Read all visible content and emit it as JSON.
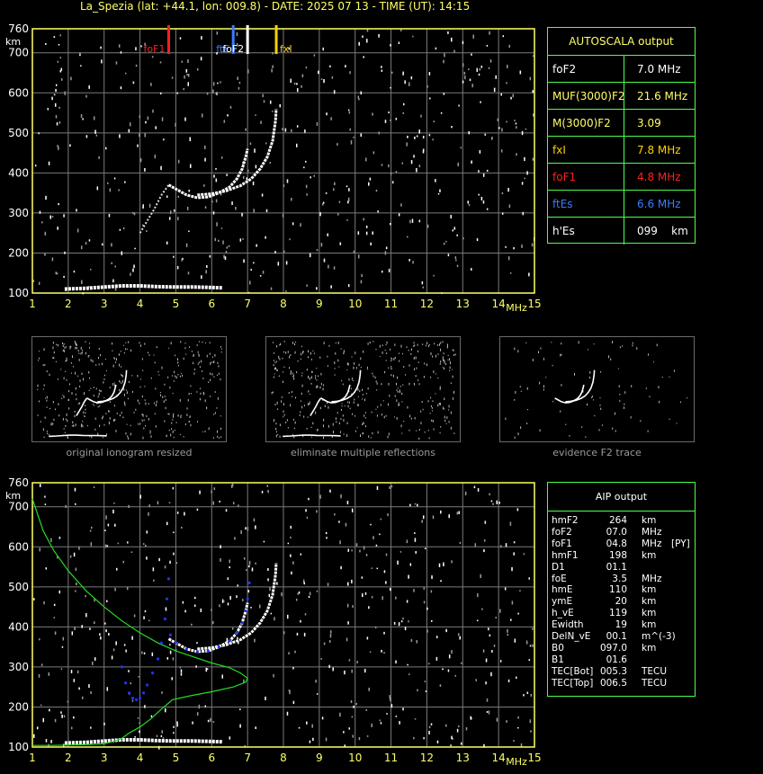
{
  "header": {
    "title": "La_Spezia (lat: +44.1, lon: 009.8) - DATE: 2025 07 13 - TIME (UT): 14:15"
  },
  "colors": {
    "axis": "#ffff66",
    "grid": "#7a7a7a",
    "panel_border": "#4cff4c",
    "foF1": "#ff2020",
    "ftEs": "#3a7bff",
    "fxI": "#ffd000",
    "foF2": "#ffffff",
    "profile": "#22dd22",
    "aip_trace": "#2233ff"
  },
  "chart_data": [
    {
      "type": "scatter",
      "name_id": "top-ionogram",
      "xlabel": "MHz",
      "ylabel": "km",
      "xlim": [
        1,
        15
      ],
      "ylim": [
        100,
        760
      ],
      "x_ticks": [
        "1",
        "2",
        "3",
        "4",
        "5",
        "6",
        "7",
        "8",
        "9",
        "10",
        "11",
        "12",
        "13",
        "14",
        "15"
      ],
      "y_ticks": [
        "100",
        "200",
        "300",
        "400",
        "500",
        "600",
        "700",
        "760"
      ],
      "grid": true,
      "markers": [
        {
          "label": "foF1",
          "x": 4.8,
          "color": "#ff2020"
        },
        {
          "label": "ftE",
          "x": 6.6,
          "color": "#3a7bff"
        },
        {
          "label": "foF2",
          "x": 7.0,
          "color": "#ffffff"
        },
        {
          "label": "fxI",
          "x": 7.8,
          "color": "#ffd000"
        }
      ],
      "traces": {
        "o_mode": [
          [
            4.8,
            370
          ],
          [
            5.0,
            360
          ],
          [
            5.3,
            345
          ],
          [
            5.6,
            338
          ],
          [
            5.9,
            340
          ],
          [
            6.2,
            350
          ],
          [
            6.5,
            365
          ],
          [
            6.7,
            385
          ],
          [
            6.85,
            410
          ],
          [
            6.95,
            440
          ],
          [
            7.0,
            460
          ]
        ],
        "x_mode": [
          [
            5.6,
            345
          ],
          [
            6.0,
            348
          ],
          [
            6.4,
            355
          ],
          [
            6.8,
            368
          ],
          [
            7.1,
            385
          ],
          [
            7.35,
            410
          ],
          [
            7.55,
            440
          ],
          [
            7.7,
            480
          ],
          [
            7.78,
            530
          ],
          [
            7.8,
            560
          ]
        ],
        "f1_ledge": [
          [
            4.0,
            250
          ],
          [
            4.2,
            280
          ],
          [
            4.4,
            310
          ],
          [
            4.6,
            345
          ],
          [
            4.8,
            370
          ]
        ],
        "e_layer": [
          [
            1.9,
            110
          ],
          [
            2.5,
            112
          ],
          [
            3.0,
            115
          ],
          [
            3.5,
            118
          ],
          [
            4.0,
            118
          ],
          [
            4.5,
            116
          ],
          [
            5.0,
            115
          ],
          [
            5.5,
            115
          ],
          [
            6.0,
            114
          ],
          [
            6.3,
            113
          ]
        ]
      }
    },
    {
      "type": "scatter",
      "name_id": "bottom-ionogram",
      "xlabel": "MHz",
      "ylabel": "km",
      "xlim": [
        1,
        15
      ],
      "ylim": [
        100,
        760
      ],
      "x_ticks": [
        "1",
        "2",
        "3",
        "4",
        "5",
        "6",
        "7",
        "8",
        "9",
        "10",
        "11",
        "12",
        "13",
        "14",
        "15"
      ],
      "y_ticks": [
        "100",
        "200",
        "300",
        "400",
        "500",
        "600",
        "700",
        "760"
      ],
      "grid": true,
      "profile": [
        [
          1.0,
          720
        ],
        [
          1.3,
          640
        ],
        [
          1.6,
          590
        ],
        [
          2.0,
          540
        ],
        [
          2.5,
          490
        ],
        [
          3.0,
          450
        ],
        [
          3.5,
          415
        ],
        [
          4.0,
          385
        ],
        [
          4.5,
          360
        ],
        [
          5.0,
          340
        ],
        [
          5.5,
          325
        ],
        [
          6.0,
          310
        ],
        [
          6.5,
          298
        ],
        [
          6.8,
          285
        ],
        [
          7.0,
          272
        ],
        [
          6.95,
          262
        ],
        [
          6.6,
          250
        ],
        [
          6.0,
          238
        ],
        [
          5.4,
          228
        ],
        [
          4.9,
          218
        ],
        [
          4.8,
          210
        ],
        [
          4.6,
          195
        ],
        [
          4.3,
          170
        ],
        [
          4.0,
          150
        ],
        [
          3.7,
          135
        ],
        [
          3.5,
          122
        ],
        [
          3.3,
          115
        ],
        [
          3.0,
          108
        ],
        [
          2.5,
          106
        ],
        [
          2.0,
          105
        ],
        [
          1.5,
          104
        ],
        [
          1.0,
          104
        ]
      ],
      "aip_trace": [
        [
          3.5,
          300
        ],
        [
          3.6,
          260
        ],
        [
          3.7,
          235
        ],
        [
          3.8,
          222
        ],
        [
          3.9,
          218
        ],
        [
          4.0,
          222
        ],
        [
          4.1,
          235
        ],
        [
          4.2,
          255
        ],
        [
          4.35,
          285
        ],
        [
          4.5,
          320
        ],
        [
          4.6,
          360
        ],
        [
          4.7,
          420
        ],
        [
          4.75,
          470
        ],
        [
          4.8,
          520
        ],
        [
          4.85,
          380
        ],
        [
          5.0,
          360
        ],
        [
          5.3,
          345
        ],
        [
          5.6,
          338
        ],
        [
          5.9,
          340
        ],
        [
          6.2,
          350
        ],
        [
          6.5,
          365
        ],
        [
          6.7,
          385
        ],
        [
          6.85,
          410
        ],
        [
          6.95,
          440
        ],
        [
          7.0,
          470
        ],
        [
          7.05,
          510
        ]
      ]
    }
  ],
  "thumbnails": [
    {
      "caption": "original ionogram resized"
    },
    {
      "caption": "eliminate multiple reflections"
    },
    {
      "caption": "evidence F2 trace"
    }
  ],
  "autoscala": {
    "title": "AUTOSCALA output",
    "rows": [
      {
        "label": "foF2",
        "value": "7.0 MHz",
        "color": "#ffffff"
      },
      {
        "label": "MUF(3000)F2",
        "value": "21.6 MHz",
        "color": "#ffff66"
      },
      {
        "label": "M(3000)F2",
        "value": "3.09",
        "color": "#ffff66"
      },
      {
        "label": "fxI",
        "value": "7.8 MHz",
        "color": "#ffd000"
      },
      {
        "label": "foF1",
        "value": "4.8 MHz",
        "color": "#ff2020"
      },
      {
        "label": "ftEs",
        "value": "6.6 MHz",
        "color": "#3a7bff"
      },
      {
        "label": "h'Es",
        "value": "099    km",
        "color": "#ffffff"
      }
    ]
  },
  "aip": {
    "title": "AIP output",
    "rows": [
      {
        "name": "hmF2",
        "value": "264",
        "unit": "km",
        "extra": ""
      },
      {
        "name": "foF2",
        "value": "07.0",
        "unit": "MHz",
        "extra": ""
      },
      {
        "name": "foF1",
        "value": "04.8",
        "unit": "MHz",
        "extra": "[PY]"
      },
      {
        "name": "hmF1",
        "value": "198",
        "unit": "km",
        "extra": ""
      },
      {
        "name": "D1",
        "value": "01.1",
        "unit": "",
        "extra": ""
      },
      {
        "name": "foE",
        "value": "3.5",
        "unit": "MHz",
        "extra": ""
      },
      {
        "name": "hmE",
        "value": "110",
        "unit": "km",
        "extra": ""
      },
      {
        "name": "ymE",
        "value": "20",
        "unit": "km",
        "extra": ""
      },
      {
        "name": "h_vE",
        "value": "119",
        "unit": "km",
        "extra": ""
      },
      {
        "name": "Ewidth",
        "value": "19",
        "unit": "km",
        "extra": ""
      },
      {
        "name": "DelN_vE",
        "value": "00.1",
        "unit": "m^(-3)",
        "extra": ""
      },
      {
        "name": "B0",
        "value": "097.0",
        "unit": "km",
        "extra": ""
      },
      {
        "name": "B1",
        "value": "01.6",
        "unit": "",
        "extra": ""
      },
      {
        "name": "TEC[Bot]",
        "value": "005.3",
        "unit": "TECU",
        "extra": ""
      },
      {
        "name": "TEC[Top]",
        "value": "006.5",
        "unit": "TECU",
        "extra": ""
      }
    ]
  }
}
